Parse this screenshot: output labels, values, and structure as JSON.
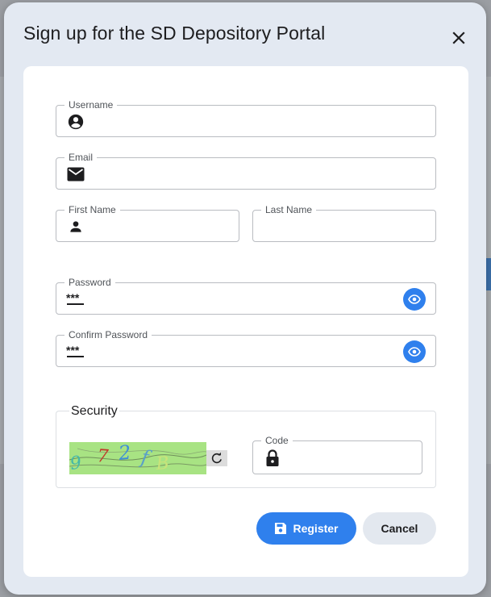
{
  "dialog": {
    "title": "Sign up for the SD Depository Portal"
  },
  "form": {
    "username": {
      "label": "Username",
      "icon": "account-circle-icon",
      "value": ""
    },
    "email": {
      "label": "Email",
      "icon": "mail-icon",
      "value": ""
    },
    "first_name": {
      "label": "First Name",
      "icon": "person-icon",
      "value": ""
    },
    "last_name": {
      "label": "Last Name",
      "value": ""
    },
    "password": {
      "label": "Password",
      "icon": "password-icon",
      "value": ""
    },
    "confirm_password": {
      "label": "Confirm Password",
      "icon": "password-icon",
      "value": ""
    }
  },
  "security": {
    "title": "Security",
    "captcha_text": "972fB",
    "code": {
      "label": "Code",
      "icon": "lock-icon",
      "value": ""
    }
  },
  "actions": {
    "register_label": "Register",
    "cancel_label": "Cancel"
  },
  "colors": {
    "accent": "#2f80ed",
    "dialog_bg": "#e3e9f2",
    "captcha_bg": "#a8e383"
  }
}
